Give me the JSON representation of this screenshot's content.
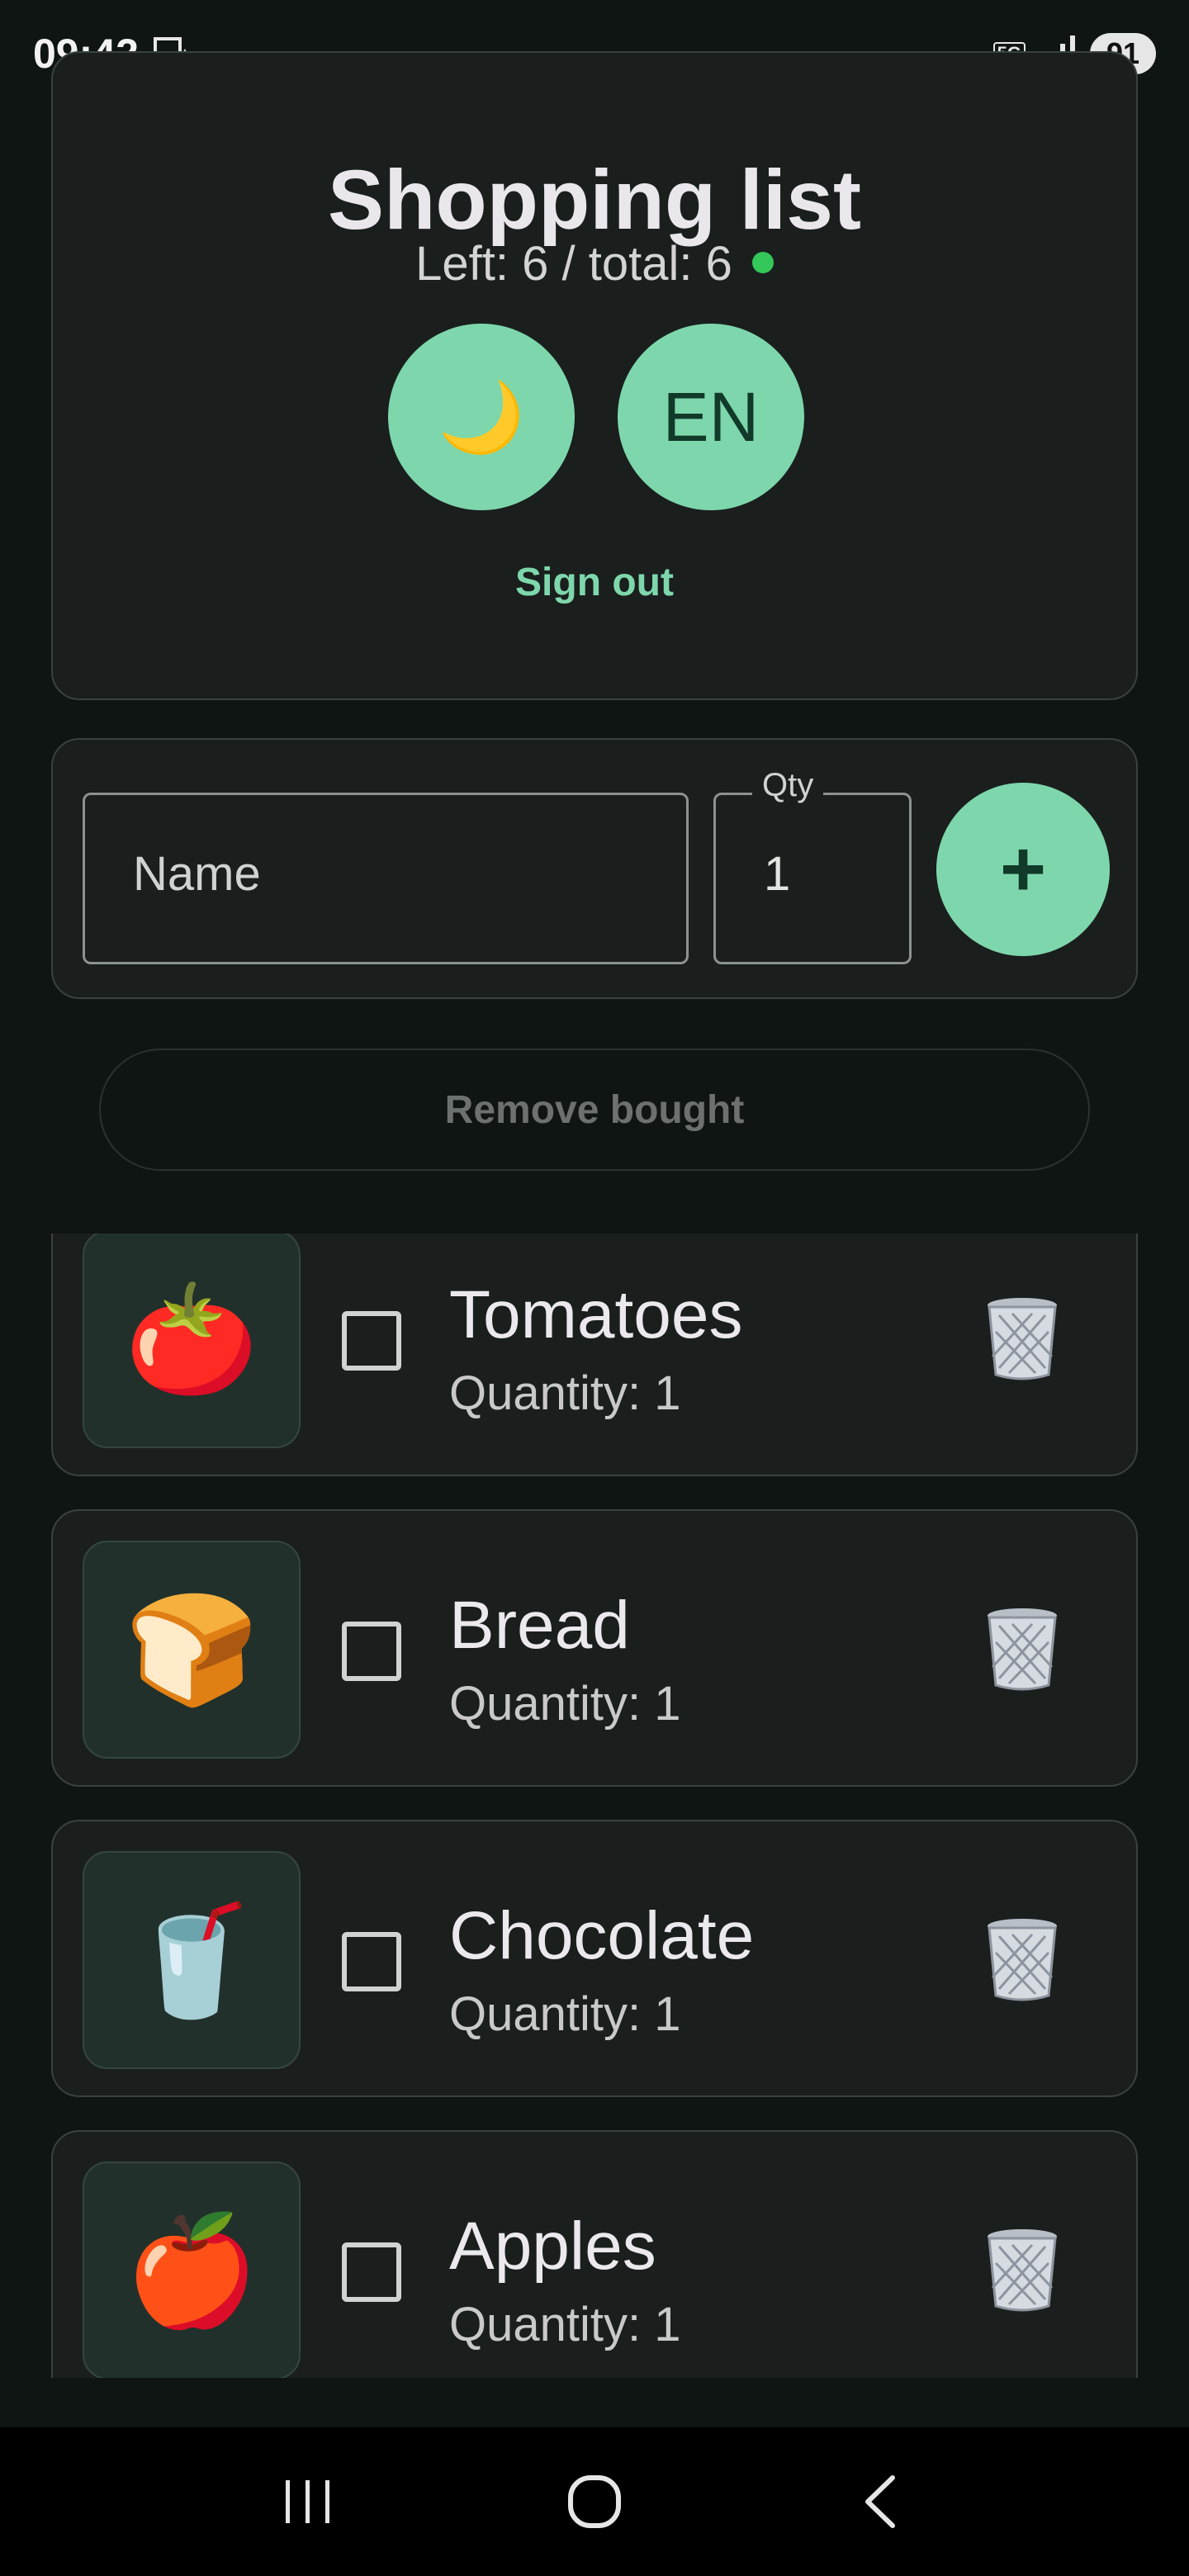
{
  "status_bar": {
    "time": "09:42",
    "network": "5G",
    "battery": "91"
  },
  "header": {
    "title": "Shopping list",
    "counter": "Left: 6 / total: 6",
    "theme_icon": "🌙",
    "lang_label": "EN",
    "sign_out": "Sign out"
  },
  "add_form": {
    "name_placeholder": "Name",
    "qty_label": "Qty",
    "qty_value": "1",
    "add_label": "+"
  },
  "remove_bought": "Remove bought",
  "items": [
    {
      "icon": "🍅",
      "icon_name": "tomato-icon",
      "name": "Tomatoes",
      "quantity": "Quantity: 1",
      "checked": false
    },
    {
      "icon": "🍞",
      "icon_name": "bread-icon",
      "name": "Bread",
      "quantity": "Quantity: 1",
      "checked": false
    },
    {
      "icon": "🥤",
      "icon_name": "cup-with-straw-icon",
      "name": "Chocolate",
      "quantity": "Quantity: 1",
      "checked": false
    },
    {
      "icon": "🍎",
      "icon_name": "apple-icon",
      "name": "Apples",
      "quantity": "Quantity: 1",
      "checked": false
    }
  ],
  "colors": {
    "accent": "#7ed7ac",
    "background": "#0f1513",
    "card": "#1a1f1e",
    "status_dot": "#34c759"
  }
}
